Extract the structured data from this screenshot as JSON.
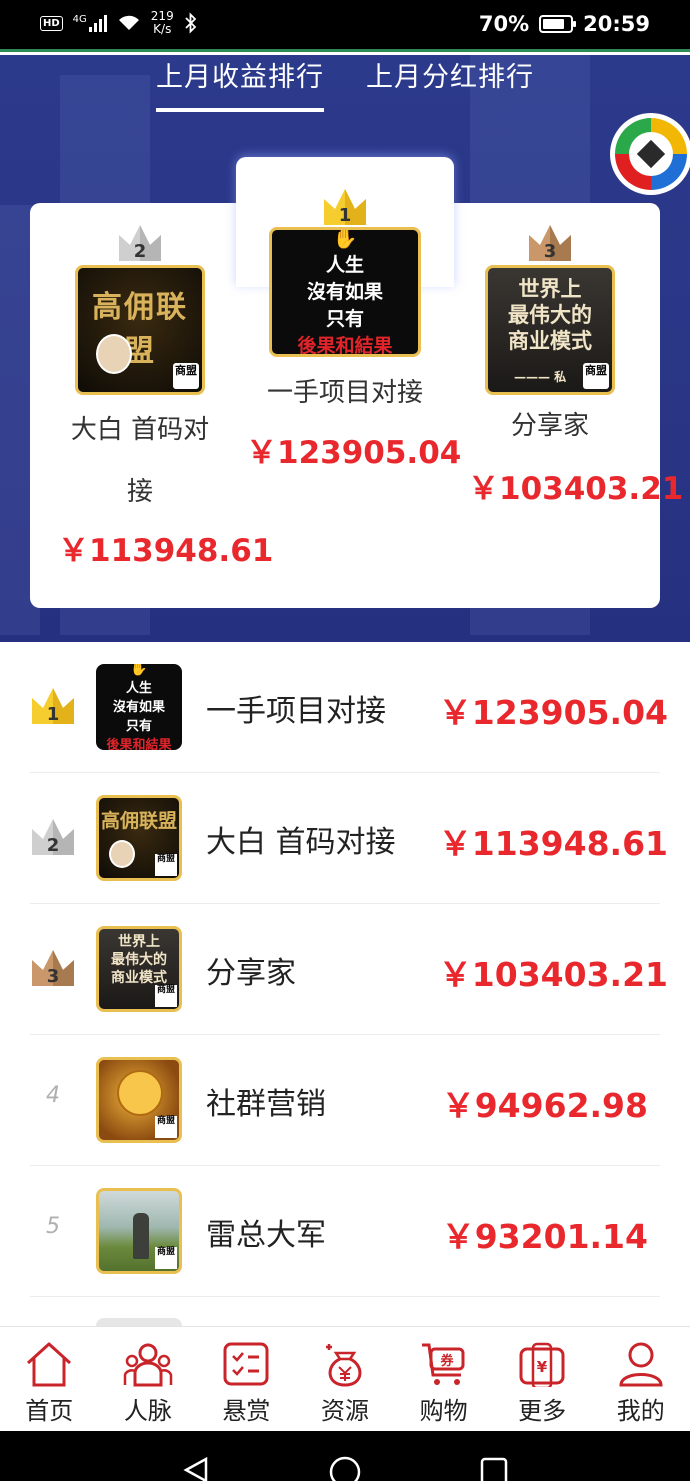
{
  "status_bar": {
    "network": "HD",
    "network_type": "4G",
    "speed_value": "219",
    "speed_unit": "K/s",
    "battery": "70%",
    "time": "20:59"
  },
  "tabs": [
    {
      "label": "上月收益排行",
      "active": true
    },
    {
      "label": "上月分红排行",
      "active": false
    }
  ],
  "podium": {
    "first": {
      "rank": "1",
      "name": "一手项目对接",
      "amount": "￥123905.04"
    },
    "second": {
      "rank": "2",
      "name_line1": "大白 首码对",
      "name_line2": "接",
      "amount": "￥113948.61"
    },
    "third": {
      "rank": "3",
      "name": "分享家",
      "amount": "￥103403.21"
    }
  },
  "avatars": {
    "black": {
      "line1": "人生",
      "line2": "沒有如果",
      "line3": "只有",
      "line4": "後果和結果"
    },
    "gold": {
      "title": "高佣联盟"
    },
    "city": {
      "line1": "世界上",
      "line2": "最伟大的",
      "line3": "商业模式",
      "sign": "——— 私"
    },
    "tag": "商盟"
  },
  "ranking": [
    {
      "rank": "1",
      "name": "一手项目对接",
      "amount": "￥123905.04"
    },
    {
      "rank": "2",
      "name": "大白 首码对接",
      "amount": "￥113948.61"
    },
    {
      "rank": "3",
      "name": "分享家",
      "amount": "￥103403.21"
    },
    {
      "rank": "4",
      "name": "社群营销",
      "amount": "￥94962.98"
    },
    {
      "rank": "5",
      "name": "雷总大军",
      "amount": "￥93201.14"
    }
  ],
  "nav": [
    {
      "label": "首页",
      "icon": "home-icon"
    },
    {
      "label": "人脉",
      "icon": "people-icon"
    },
    {
      "label": "悬赏",
      "icon": "checklist-icon"
    },
    {
      "label": "资源",
      "icon": "money-bag-icon"
    },
    {
      "label": "购物",
      "icon": "cart-icon"
    },
    {
      "label": "更多",
      "icon": "wallet-icon"
    },
    {
      "label": "我的",
      "icon": "user-icon"
    }
  ],
  "colors": {
    "hero_blue": "#2c3a8c",
    "amount_red": "#e8282d",
    "gold": "#f1c232",
    "silver": "#c9c9c9",
    "bronze": "#b98a5e",
    "nav_red": "#c8242a"
  }
}
